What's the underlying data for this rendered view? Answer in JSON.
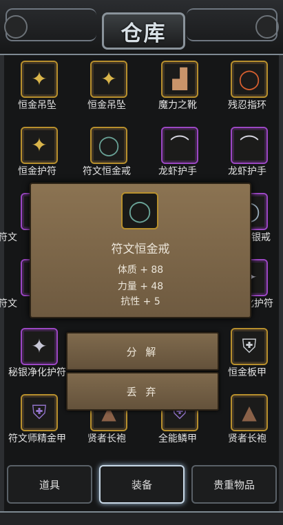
{
  "title": "仓库",
  "items": [
    {
      "name": "恒金吊坠",
      "icon": "pendant-icon",
      "rarity": "gold"
    },
    {
      "name": "恒金吊坠",
      "icon": "pendant-icon",
      "rarity": "gold"
    },
    {
      "name": "魔力之靴",
      "icon": "boots-icon",
      "rarity": "gold"
    },
    {
      "name": "残忍指环",
      "icon": "ring-icon",
      "rarity": "gold"
    },
    {
      "name": "恒金护符",
      "icon": "amulet-icon",
      "rarity": "gold"
    },
    {
      "name": "符文恒金戒",
      "icon": "ring-icon",
      "rarity": "gold"
    },
    {
      "name": "龙虾护手",
      "icon": "gauntlet-icon",
      "rarity": "purple"
    },
    {
      "name": "龙虾护手",
      "icon": "gauntlet-icon",
      "rarity": "purple"
    },
    {
      "name": "符文",
      "icon": "ring-icon",
      "rarity": "purple"
    },
    {
      "name": "秘银戒",
      "icon": "ring-icon",
      "rarity": "purple"
    },
    {
      "name": "符文",
      "icon": "ring-icon",
      "rarity": "purple"
    },
    {
      "name": "化护符",
      "icon": "amulet-icon",
      "rarity": "purple"
    },
    {
      "name": "秘银净化护符",
      "icon": "amulet-icon",
      "rarity": "purple"
    },
    {
      "name": "恒金板甲",
      "icon": "armor-icon",
      "rarity": "gold"
    },
    {
      "name": "符文师精金甲",
      "icon": "armor-icon",
      "rarity": "gold"
    },
    {
      "name": "贤者长袍",
      "icon": "robe-icon",
      "rarity": "gold"
    },
    {
      "name": "全能鳞甲",
      "icon": "armor-icon",
      "rarity": "gold"
    },
    {
      "name": "贤者长袍",
      "icon": "robe-icon",
      "rarity": "gold"
    }
  ],
  "detail": {
    "name": "符文恒金戒",
    "icon": "ring-icon",
    "stats": [
      "体质 + 88",
      "力量 + 48",
      "抗性 + 5"
    ]
  },
  "actions": {
    "decompose": "分 解",
    "discard": "丢 弃"
  },
  "tabs": [
    "道具",
    "装备",
    "贵重物品"
  ]
}
